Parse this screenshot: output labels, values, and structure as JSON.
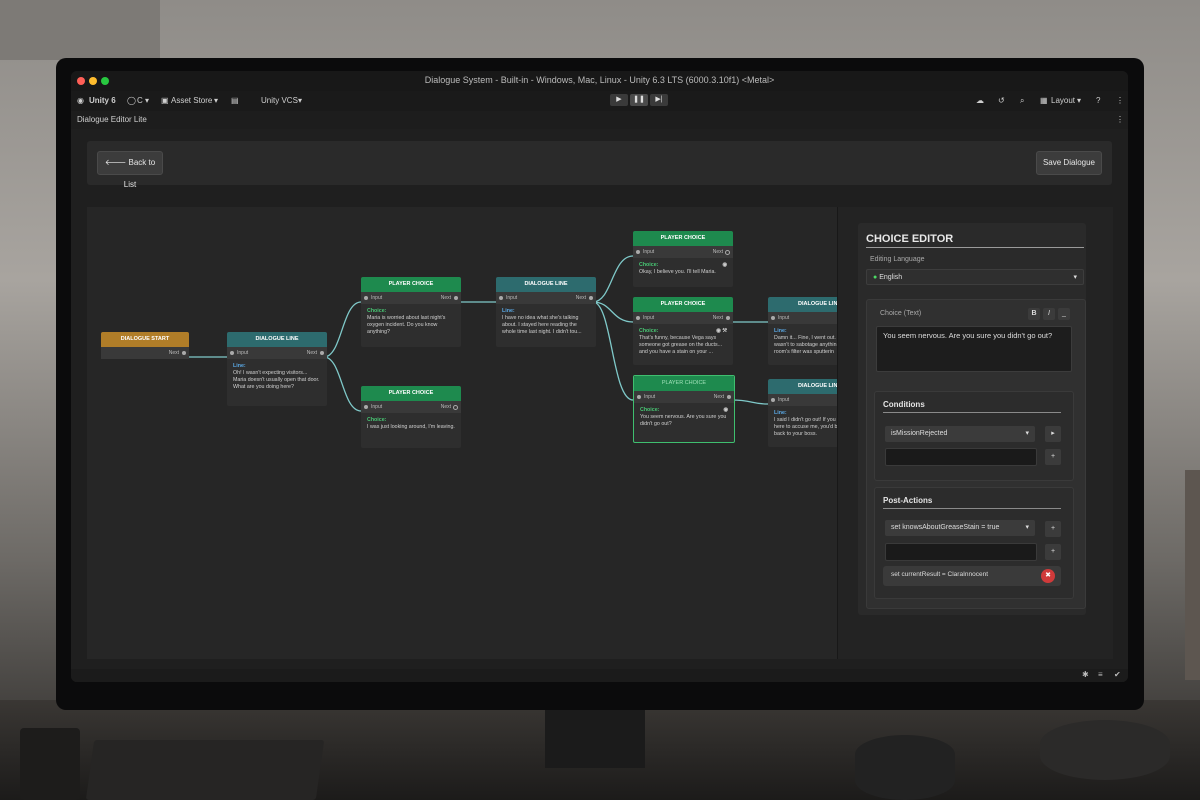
{
  "window": {
    "title": "Dialogue System - Built-in - Windows, Mac, Linux - Unity 6.3 LTS (6000.3.10f1) <Metal>"
  },
  "toolbar": {
    "unity_label": "Unity 6",
    "account_label": "C",
    "asset_store_label": "Asset Store",
    "vcs_label": "Unity VCS",
    "layout_label": "Layout"
  },
  "tab": {
    "label": "Dialogue Editor Lite"
  },
  "header": {
    "back_label": "Back to List",
    "save_label": "Save Dialogue"
  },
  "ports": {
    "input": "Input",
    "next": "Next"
  },
  "nodes": {
    "start": {
      "title": "DIALOGUE START"
    },
    "line1": {
      "title": "DIALOGUE LINE",
      "label": "Line:",
      "text": "Oh! I wasn't expecting visitors... Maria doesn't usually open that door. What are you doing here?"
    },
    "choice1": {
      "title": "PLAYER CHOICE",
      "label": "Choice:",
      "text": "Maria is worried about last night's oxygen incident. Do you know anything?"
    },
    "choice2": {
      "title": "PLAYER CHOICE",
      "label": "Choice:",
      "text": "I was just looking around, I'm leaving."
    },
    "line2": {
      "title": "DIALOGUE LINE",
      "label": "Line:",
      "text": "I have no idea what she's talking about. I stayed here reading the whole time last night. I didn't tou..."
    },
    "choice3": {
      "title": "PLAYER CHOICE",
      "label": "Choice:",
      "text": "Okay, I believe you. I'll tell Maria."
    },
    "choice4": {
      "title": "PLAYER CHOICE",
      "label": "Choice:",
      "text": "That's funny, because Vega says someone got grease on the ducts... and you have a stain on your ..."
    },
    "choice5": {
      "title": "PLAYER CHOICE",
      "label": "Choice:",
      "text": "You seem nervous. Are you sure you didn't go out?"
    },
    "line3": {
      "title": "DIALOGUE LINE",
      "label": "Line:",
      "text": "Damn it... Fine, I went out. wasn't to sabotage anythin room's filter was sputterin"
    },
    "line4": {
      "title": "DIALOGUE LINE",
      "label": "Line:",
      "text": "I said I didn't go out! If you here to accuse me, you'd b back to your boss."
    }
  },
  "inspector": {
    "title": "CHOICE EDITOR",
    "language_label": "Editing Language",
    "language_value": "English",
    "choice_text_label": "Choice (Text)",
    "bold_btn": "B",
    "italic_btn": "I",
    "under_btn": "_",
    "choice_text_value": "You seem nervous. Are you sure you didn't go out?",
    "conditions_title": "Conditions",
    "condition_value": "isMissionRejected",
    "post_actions_title": "Post-Actions",
    "action1_value": "set knowsAboutGreaseStain = true",
    "action2_value": "set currentResult = ClaraInnocent",
    "add_symbol": "+",
    "remove_symbol": "✖"
  },
  "colors": {
    "choice_header": "#1e8a4e",
    "line_header": "#2d6b6e",
    "start_header": "#b07d28",
    "remove_red": "#d03a3a"
  }
}
